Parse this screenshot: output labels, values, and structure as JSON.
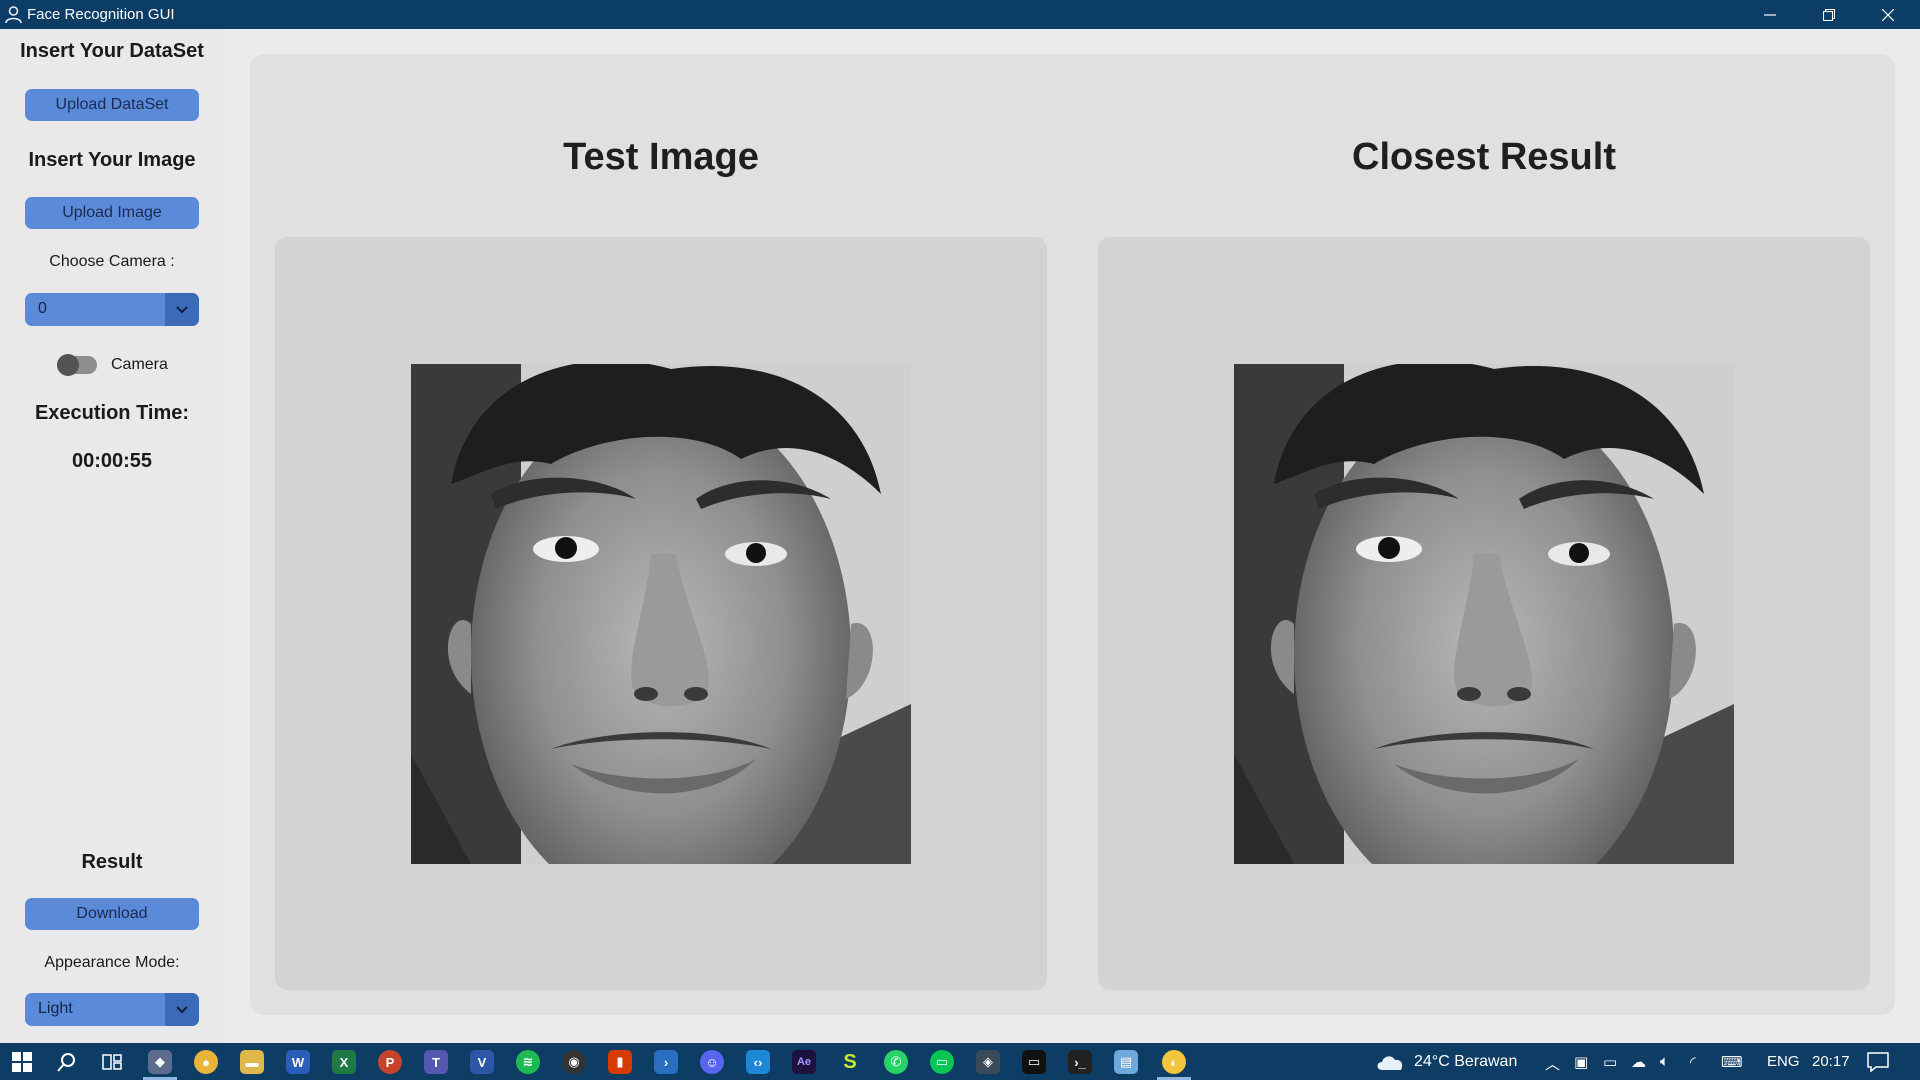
{
  "window": {
    "title": "Face Recognition GUI",
    "minimize_icon": "minimize-icon",
    "maximize_icon": "restore-icon",
    "close_icon": "close-icon"
  },
  "sidebar": {
    "dataset_heading": "Insert Your DataSet",
    "upload_dataset_label": "Upload DataSet",
    "image_heading": "Insert Your Image",
    "upload_image_label": "Upload Image",
    "camera_label": "Choose Camera :",
    "camera_value": "0",
    "camera_toggle_label": "Camera",
    "camera_toggle_on": false,
    "execution_heading": "Execution Time:",
    "execution_time": "00:00:55",
    "result_heading": "Result",
    "download_label": "Download",
    "appearance_label": "Appearance Mode:",
    "appearance_value": "Light"
  },
  "main": {
    "test_title": "Test Image",
    "result_title": "Closest Result"
  },
  "taskbar": {
    "weather": "24°C  Berawan",
    "language": "ENG",
    "time": "20:17",
    "apps": [
      "start",
      "search",
      "task-view",
      "app-dev",
      "chrome",
      "file-explorer",
      "word",
      "excel",
      "powerpoint",
      "teams",
      "visio",
      "spotify",
      "obs",
      "office",
      "powershell",
      "discord",
      "vscode",
      "after-effects",
      "app-s",
      "whatsapp",
      "line",
      "git",
      "terminal",
      "cmd",
      "notepad",
      "python"
    ]
  },
  "colors": {
    "titlebar": "#0b3d66",
    "accent": "#5b8ad9",
    "accent_dark": "#3a6ab8",
    "taskbar": "#0d3c64"
  }
}
